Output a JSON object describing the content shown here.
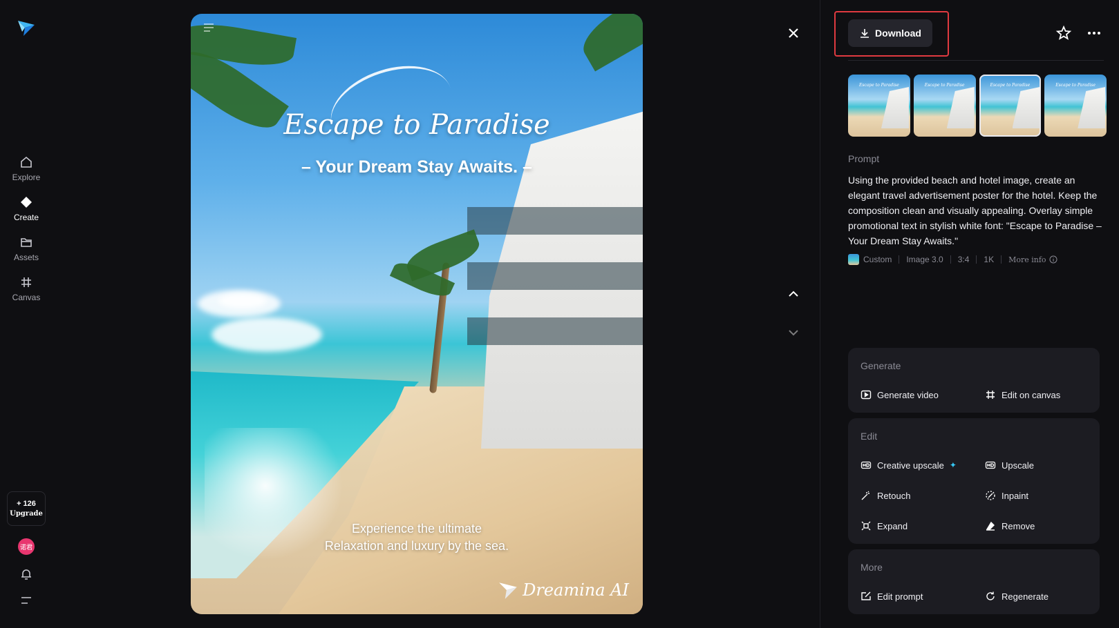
{
  "nav": {
    "items": [
      {
        "label": "Explore",
        "icon": "home-icon"
      },
      {
        "label": "Create",
        "icon": "diamond-icon"
      },
      {
        "label": "Assets",
        "icon": "folder-icon"
      },
      {
        "label": "Canvas",
        "icon": "canvas-icon"
      }
    ],
    "credits": "+ 126",
    "upgrade": "Upgrade",
    "avatar_text": "诺君"
  },
  "poster": {
    "title": "Escape to Paradise",
    "subtitle": "– Your Dream Stay Awaits. –",
    "body_line1": "Experience the ultimate",
    "body_line2": "Relaxation and luxury by the sea.",
    "brand": "Dreamina AI"
  },
  "panel": {
    "download_label": "Download",
    "prompt_label": "Prompt",
    "prompt_text": "Using the provided beach and hotel image, create an elegant travel advertisement poster for the hotel. Keep the composition clean and visually appealing. Overlay simple promotional text in stylish white font: \"Escape to Paradise – Your Dream Stay Awaits.\"",
    "meta": {
      "custom": "Custom",
      "model": "Image 3.0",
      "ratio": "3:4",
      "resolution": "1K",
      "more_info": "More info"
    },
    "generate": {
      "title": "Generate",
      "generate_video": "Generate video",
      "edit_on_canvas": "Edit on canvas"
    },
    "edit": {
      "title": "Edit",
      "creative_upscale": "Creative upscale",
      "upscale": "Upscale",
      "retouch": "Retouch",
      "inpaint": "Inpaint",
      "expand": "Expand",
      "remove": "Remove"
    },
    "more": {
      "title": "More",
      "edit_prompt": "Edit prompt",
      "regenerate": "Regenerate"
    },
    "thumb_text": "Escape to Paradise"
  },
  "colors": {
    "background": "#0f0f12",
    "card": "#1c1c22",
    "highlight": "#e03a40",
    "accent": "#36c8f5"
  }
}
